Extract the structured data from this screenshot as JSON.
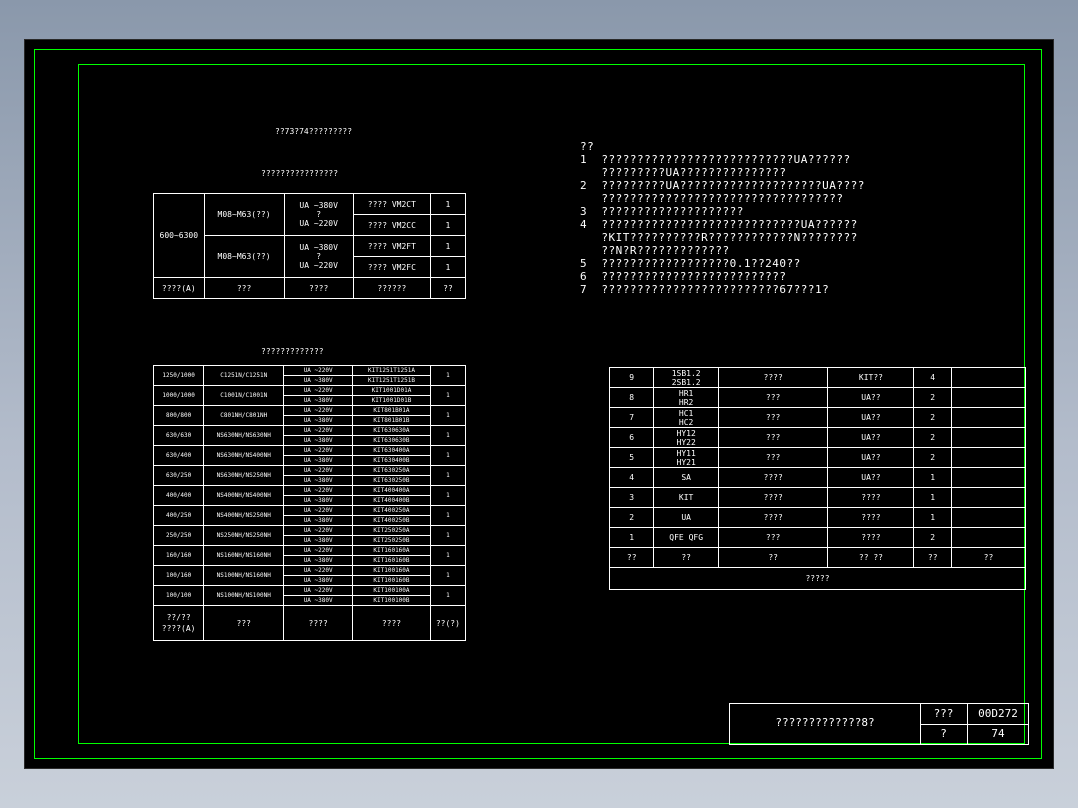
{
  "table1": {
    "title": "??73?74?????????",
    "subtitle": "????????????????",
    "range": "600~6300",
    "rows": [
      {
        "device": "M08~M63(??)",
        "volt_a": "UA   ~380V",
        "volt_mid": "?",
        "volt_b": "UA   ~220V",
        "code_a": "????  VM2CT",
        "qty_a": "1",
        "code_b": "????  VM2CC",
        "qty_b": "1"
      },
      {
        "device": "M08~M63(??)",
        "volt_a": "UA   ~380V",
        "volt_mid": "?",
        "volt_b": "UA   ~220V",
        "code_a": "????  VM2FT",
        "qty_a": "1",
        "code_b": "????  VM2FC",
        "qty_b": "1"
      }
    ],
    "footer": [
      "????(A)",
      "???",
      "????",
      "??????",
      "??"
    ]
  },
  "table2": {
    "title": "?????????????",
    "rows": [
      {
        "range": "1250/1000",
        "breaker": "C1251N/C1251N",
        "v1": "UA   ~220V",
        "v2": "UA   ~380V",
        "c1": "KIT1251T1251A",
        "c2": "KIT1251T1251B",
        "qty": "1"
      },
      {
        "range": "1000/1000",
        "breaker": "C1001N/C1001N",
        "v1": "UA   ~220V",
        "v2": "UA   ~380V",
        "c1": "KIT1001D01A",
        "c2": "KIT1001D01B",
        "qty": "1"
      },
      {
        "range": "800/800",
        "breaker": "C801NH/C801NH",
        "v1": "UA   ~220V",
        "v2": "UA   ~380V",
        "c1": "KIT801B01A",
        "c2": "KIT801B01B",
        "qty": "1"
      },
      {
        "range": "630/630",
        "breaker": "NS630NH/NS630NH",
        "v1": "UA   ~220V",
        "v2": "UA   ~380V",
        "c1": "KIT630630A",
        "c2": "KIT630630B",
        "qty": "1"
      },
      {
        "range": "630/400",
        "breaker": "NS630NH/NS400NH",
        "v1": "UA   ~220V",
        "v2": "UA   ~380V",
        "c1": "KIT630400A",
        "c2": "KIT630400B",
        "qty": "1"
      },
      {
        "range": "630/250",
        "breaker": "NS630NH/NS250NH",
        "v1": "UA   ~220V",
        "v2": "UA   ~380V",
        "c1": "KIT630250A",
        "c2": "KIT630250B",
        "qty": "1"
      },
      {
        "range": "400/400",
        "breaker": "NS400NH/NS400NH",
        "v1": "UA   ~220V",
        "v2": "UA   ~380V",
        "c1": "KIT400400A",
        "c2": "KIT400400B",
        "qty": "1"
      },
      {
        "range": "400/250",
        "breaker": "NS400NH/NS250NH",
        "v1": "UA   ~220V",
        "v2": "UA   ~380V",
        "c1": "KIT400250A",
        "c2": "KIT400250B",
        "qty": "1"
      },
      {
        "range": "250/250",
        "breaker": "NS250NH/NS250NH",
        "v1": "UA   ~220V",
        "v2": "UA   ~380V",
        "c1": "KIT250250A",
        "c2": "KIT250250B",
        "qty": "1"
      },
      {
        "range": "160/160",
        "breaker": "NS160NH/NS160NH",
        "v1": "UA   ~220V",
        "v2": "UA   ~380V",
        "c1": "KIT160160A",
        "c2": "KIT160160B",
        "qty": "1"
      },
      {
        "range": "100/160",
        "breaker": "NS100NH/NS160NH",
        "v1": "UA   ~220V",
        "v2": "UA   ~380V",
        "c1": "KIT100160A",
        "c2": "KIT100160B",
        "qty": "1"
      },
      {
        "range": "100/100",
        "breaker": "NS100NH/NS100NH",
        "v1": "UA   ~220V",
        "v2": "UA   ~380V",
        "c1": "KIT100100A",
        "c2": "KIT100100B",
        "qty": "1"
      }
    ],
    "footer": {
      "range_a": "??/??",
      "range_b": "????(A)",
      "col2": "???",
      "col3": "????",
      "col4": "????",
      "col5": "??(?)"
    }
  },
  "notes": [
    "??",
    "1  ???????????????????????????UA??????",
    "   ?????????UA???????????????",
    "2  ?????????UA????????????????????UA????",
    "   ??????????????????????????????????",
    "3  ????????????????????",
    "4  ????????????????????????????UA??????",
    "   ?KIT??????????R????????????N????????",
    "   ??N?R?????????????",
    "5  ??????????????????0.1??240??",
    "6  ??????????????????????????",
    "7  ?????????????????????????67???1?"
  ],
  "table3": {
    "rows": [
      {
        "no": "9",
        "sym_a": "1SB1.2",
        "sym_b": "2SB1.2",
        "name": "????",
        "model": "KIT??",
        "qty": "4",
        "note": ""
      },
      {
        "no": "8",
        "sym_a": "HR1",
        "sym_b": "HR2",
        "name": "???",
        "model": "UA??",
        "qty": "2",
        "note": ""
      },
      {
        "no": "7",
        "sym_a": "HC1",
        "sym_b": "HC2",
        "name": "???",
        "model": "UA??",
        "qty": "2",
        "note": ""
      },
      {
        "no": "6",
        "sym_a": "HY12",
        "sym_b": "HY22",
        "name": "???",
        "model": "UA??",
        "qty": "2",
        "note": ""
      },
      {
        "no": "5",
        "sym_a": "HY11",
        "sym_b": "HY21",
        "name": "???",
        "model": "UA??",
        "qty": "2",
        "note": ""
      },
      {
        "no": "4",
        "sym_a": "SA",
        "sym_b": "",
        "name": "????",
        "model": "UA??",
        "qty": "1",
        "note": ""
      },
      {
        "no": "3",
        "sym_a": "KIT",
        "sym_b": "",
        "name": "????",
        "model": "????",
        "qty": "1",
        "note": ""
      },
      {
        "no": "2",
        "sym_a": "UA",
        "sym_b": "",
        "name": "????",
        "model": "????",
        "qty": "1",
        "note": ""
      },
      {
        "no": "1",
        "sym_a": "QFE   QFG",
        "sym_b": "",
        "name": "???",
        "model": "????",
        "qty": "2",
        "note": ""
      }
    ],
    "header": [
      "??",
      "??",
      "??",
      "??    ??",
      "??",
      "??"
    ],
    "caption": "?????"
  },
  "title_block": {
    "name": "?????????????8?",
    "label_a": "???",
    "value_a": "00D272",
    "label_b": "?",
    "value_b": "74"
  },
  "colors": {
    "frame": "#00ff00",
    "background": "#000000",
    "lines": "#ffffff"
  }
}
